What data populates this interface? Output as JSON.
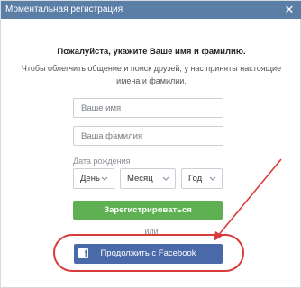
{
  "window": {
    "title": "Моментальная регистрация",
    "close_glyph": "✕"
  },
  "form": {
    "heading": "Пожалуйста, укажите Ваше имя и фамилию.",
    "hint_line1": "Чтобы облегчить общение и поиск друзей, у нас приняты настоящие",
    "hint_line2": "имена и фамилии.",
    "first_name_placeholder": "Ваше имя",
    "last_name_placeholder": "Ваша фамилия",
    "dob_label": "Дата рождения",
    "day_value": "День",
    "month_value": "Месяц",
    "year_value": "Год",
    "register_label": "Зарегистрироваться",
    "or_label": "или",
    "facebook_label": "Продолжить с Facebook",
    "facebook_icon_glyph": "f"
  },
  "colors": {
    "titlebar": "#5b7ea6",
    "register_button": "#5fb053",
    "facebook_button": "#4a69a8",
    "annotation": "#d93a3a"
  },
  "icons": {
    "close": "close-icon",
    "chevron": "chevron-down-icon",
    "facebook": "facebook-icon"
  }
}
